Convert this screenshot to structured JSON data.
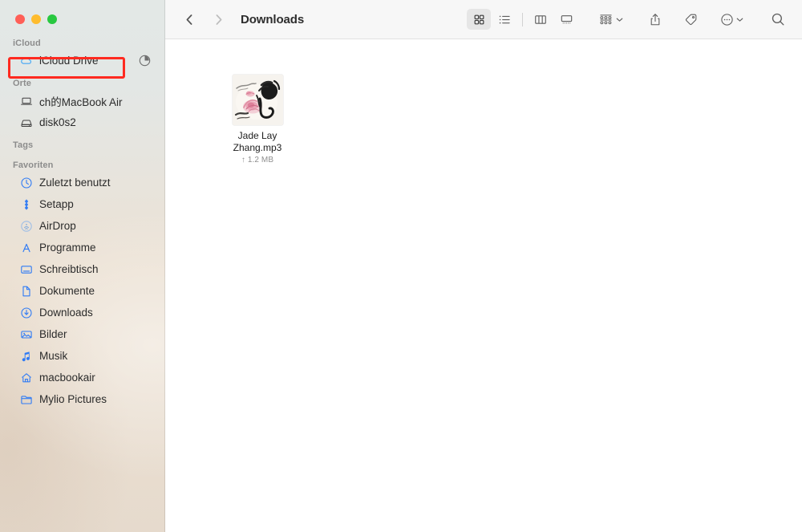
{
  "window": {
    "title": "Downloads",
    "traffic_lights": [
      {
        "name": "close",
        "color": "#ff5f57"
      },
      {
        "name": "minimize",
        "color": "#febc2e"
      },
      {
        "name": "maximize",
        "color": "#28c840"
      }
    ]
  },
  "toolbar": {
    "back_label": "Back",
    "forward_label": "Forward",
    "view_buttons": [
      {
        "name": "icon-view",
        "label": "As Icons",
        "active": true
      },
      {
        "name": "list-view",
        "label": "As List",
        "active": false
      },
      {
        "name": "column-view",
        "label": "As Columns",
        "active": false
      },
      {
        "name": "gallery-view",
        "label": "As Gallery",
        "active": false
      }
    ],
    "group_label": "Group",
    "share_label": "Share",
    "tags_label": "Tags",
    "more_label": "More",
    "search_label": "Search"
  },
  "sidebar": {
    "sections": [
      {
        "header": "iCloud",
        "items": [
          {
            "name": "icloud-drive",
            "label": "iCloud Drive",
            "icon": "cloud-icon",
            "selected": true,
            "trailing": "pie-progress-icon",
            "highlighted": true
          }
        ]
      },
      {
        "header": "Orte",
        "items": [
          {
            "name": "ch-macbook-air",
            "label": "ch的MacBook Air",
            "icon": "laptop-icon"
          },
          {
            "name": "disk0s2",
            "label": "disk0s2",
            "icon": "harddisk-icon"
          }
        ]
      },
      {
        "header": "Tags",
        "items": []
      },
      {
        "header": "Favoriten",
        "items": [
          {
            "name": "zuletzt-benutzt",
            "label": "Zuletzt benutzt",
            "icon": "clock-icon"
          },
          {
            "name": "setapp",
            "label": "Setapp",
            "icon": "setapp-icon"
          },
          {
            "name": "airdrop",
            "label": "AirDrop",
            "icon": "airdrop-icon"
          },
          {
            "name": "programme",
            "label": "Programme",
            "icon": "applications-icon"
          },
          {
            "name": "schreibtisch",
            "label": "Schreibtisch",
            "icon": "desktop-icon"
          },
          {
            "name": "dokumente",
            "label": "Dokumente",
            "icon": "document-icon"
          },
          {
            "name": "downloads",
            "label": "Downloads",
            "icon": "download-icon"
          },
          {
            "name": "bilder",
            "label": "Bilder",
            "icon": "pictures-icon"
          },
          {
            "name": "musik",
            "label": "Musik",
            "icon": "music-icon"
          },
          {
            "name": "macbookair",
            "label": "macbookair",
            "icon": "home-icon"
          },
          {
            "name": "mylio-pictures",
            "label": "Mylio Pictures",
            "icon": "folder-icon"
          }
        ]
      }
    ]
  },
  "annotation": {
    "color": "#ff2a20",
    "target": "iCloud Drive"
  },
  "files": [
    {
      "name": "Jade Lay Zhang.mp3",
      "meta": "↑ 1.2 MB",
      "thumbnail": "chinese-ink-lotus-album-art"
    }
  ]
}
